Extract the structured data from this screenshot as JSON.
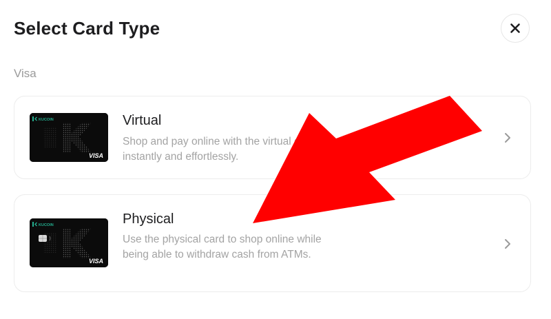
{
  "header": {
    "title": "Select Card Type",
    "close_icon": "close-icon"
  },
  "section": {
    "label": "Visa"
  },
  "options": [
    {
      "title": "Virtual",
      "description": "Shop and pay online with the virtual card, instantly and effortlessly.",
      "card_brand": "KUCOIN",
      "card_network": "VISA"
    },
    {
      "title": "Physical",
      "description": "Use the physical card to shop online while being able to withdraw cash from ATMs.",
      "card_brand": "KUCOIN",
      "card_network": "VISA"
    }
  ],
  "colors": {
    "brand_green": "#24ae8f",
    "annotation_arrow": "#ff0000",
    "card_bg": "#0b0b0b"
  }
}
